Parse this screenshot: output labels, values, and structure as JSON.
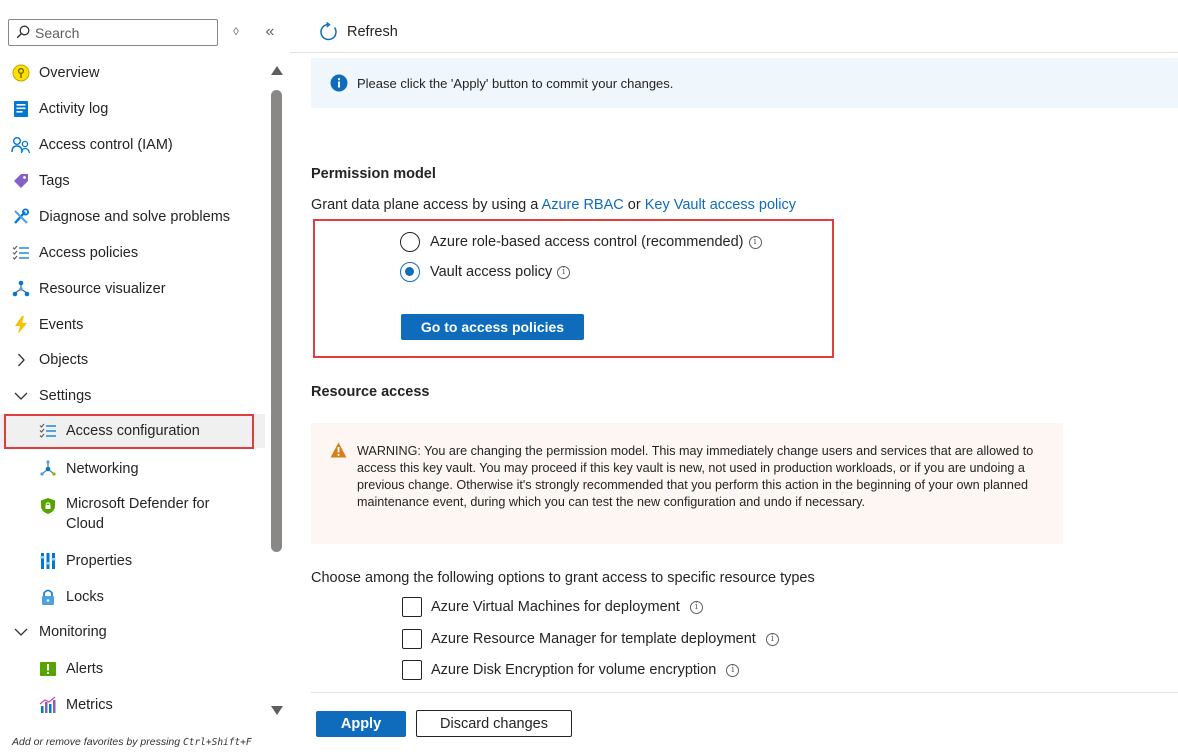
{
  "sidebar": {
    "search_placeholder": "Search",
    "items": [
      {
        "label": "Overview",
        "icon": "key-bulb-icon"
      },
      {
        "label": "Activity log",
        "icon": "activity-log-icon"
      },
      {
        "label": "Access control (IAM)",
        "icon": "people-icon"
      },
      {
        "label": "Tags",
        "icon": "tag-icon"
      },
      {
        "label": "Diagnose and solve problems",
        "icon": "wrench-icon"
      },
      {
        "label": "Access policies",
        "icon": "list-check-icon"
      },
      {
        "label": "Resource visualizer",
        "icon": "hierarchy-icon"
      },
      {
        "label": "Events",
        "icon": "lightning-icon"
      },
      {
        "label": "Objects",
        "icon": "chevron-right-icon"
      },
      {
        "label": "Settings",
        "icon": "chevron-down-icon"
      },
      {
        "label": "Access configuration",
        "icon": "list-check-icon"
      },
      {
        "label": "Networking",
        "icon": "network-icon"
      },
      {
        "label": "Microsoft Defender for Cloud",
        "icon": "shield-icon"
      },
      {
        "label": "Properties",
        "icon": "properties-icon"
      },
      {
        "label": "Locks",
        "icon": "lock-icon"
      },
      {
        "label": "Monitoring",
        "icon": "chevron-down-icon"
      },
      {
        "label": "Alerts",
        "icon": "alert-icon"
      },
      {
        "label": "Metrics",
        "icon": "metrics-icon"
      }
    ],
    "fav_hint_prefix": "Add or remove favorites by pressing",
    "fav_hint_keys": "Ctrl+Shift+F"
  },
  "toolbar": {
    "refresh_label": "Refresh"
  },
  "info_banner": "Please click the 'Apply' button to commit your changes.",
  "permission_model": {
    "title": "Permission model",
    "grant_prefix": "Grant data plane access by using a",
    "link_rbac": "Azure RBAC",
    "grant_or": "or",
    "link_policy": "Key Vault access policy",
    "option_rbac": "Azure role-based access control (recommended)",
    "option_policy": "Vault access policy",
    "selected": "Vault access policy",
    "go_button": "Go to access policies"
  },
  "resource_access": {
    "title": "Resource access",
    "warning": "WARNING: You are changing the permission model. This may immediately change users and services that are allowed to access this key vault. You may proceed if this key vault is new, not used in production workloads, or if you are undoing a previous change. Otherwise it's strongly recommended that you perform this action in the beginning of your own planned maintenance event, during which you can test the new configuration and undo if necessary.",
    "choose_text": "Choose among the following options to grant access to specific resource types",
    "options": [
      {
        "label": "Azure Virtual Machines for deployment",
        "checked": false
      },
      {
        "label": "Azure Resource Manager for template deployment",
        "checked": false
      },
      {
        "label": "Azure Disk Encryption for volume encryption",
        "checked": false
      }
    ]
  },
  "footer": {
    "apply_label": "Apply",
    "discard_label": "Discard changes"
  },
  "colors": {
    "accent": "#0f6cbd",
    "highlight_border": "#e03e3e",
    "info_bg": "#eff6fc",
    "warning_bg": "#fdf6f3",
    "warning_icon": "#d67f1a"
  }
}
